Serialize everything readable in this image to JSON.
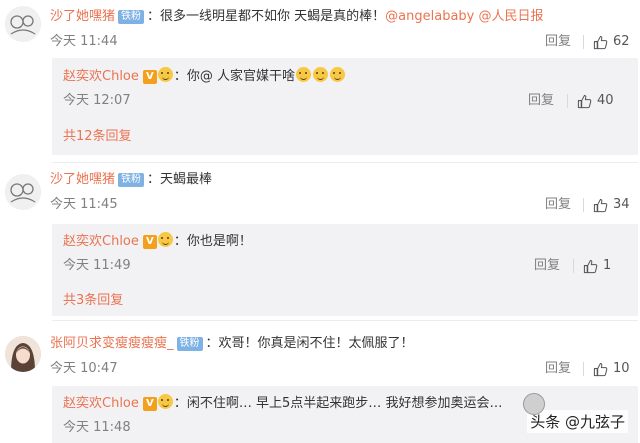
{
  "comments": [
    {
      "user": "沙了她嘿猪",
      "badge": "铁粉",
      "text": "很多一线明星都不如你 天蝎是真的棒！",
      "mentions": "@angelababy @人民日报",
      "time": "今天 11:44",
      "reply": "回复",
      "likes": "62",
      "sub": {
        "user": "赵奕欢Chloe",
        "text": "你@ 人家官媒干啥",
        "time": "今天 12:07",
        "reply": "回复",
        "likes": "40"
      },
      "more": "共12条回复"
    },
    {
      "user": "沙了她嘿猪",
      "badge": "铁粉",
      "text": "天蝎最棒",
      "time": "今天 11:45",
      "reply": "回复",
      "likes": "34",
      "sub": {
        "user": "赵奕欢Chloe",
        "text": "你也是啊！",
        "time": "今天 11:49",
        "reply": "回复",
        "likes": "1"
      },
      "more": "共3条回复"
    },
    {
      "user": "张阿贝求变瘦瘦瘦瘦_",
      "badge": "铁粉",
      "text": "欢哥！你真是闲不住！太佩服了！",
      "time": "今天 10:47",
      "reply": "回复",
      "likes": "10",
      "sub": {
        "user": "赵奕欢Chloe",
        "text": "闲不住啊… 早上5点半起来跑步… 我好想参加奥运会…",
        "time": "今天 11:48"
      }
    }
  ],
  "icons": {
    "verified": "V",
    "like": "thumbs-up-icon",
    "emoji": "grin-emoji-icon"
  },
  "watermark": "头条 @九弦子",
  "colors": {
    "username": "#eb7350",
    "badge": "#7fb2e4",
    "subbox": "#f2f2f5",
    "muted": "#808080"
  }
}
